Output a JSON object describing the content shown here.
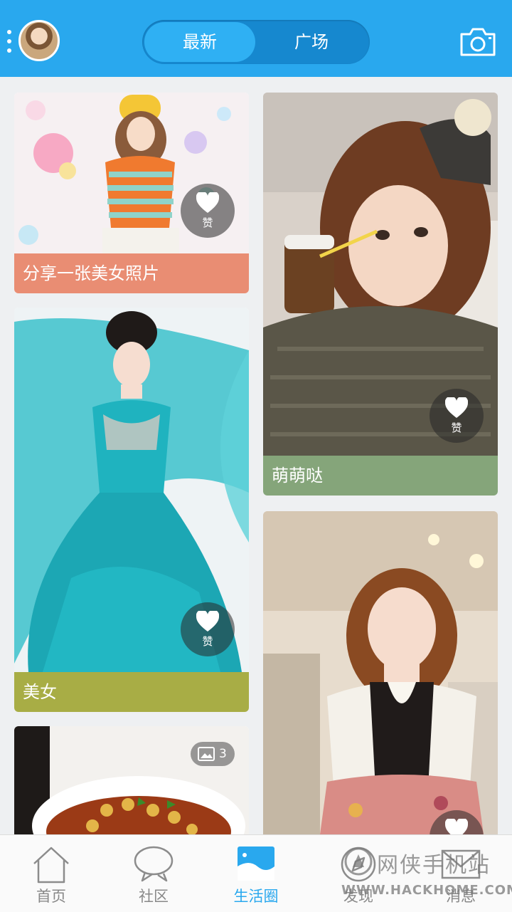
{
  "header": {
    "tabs": [
      {
        "label": "最新",
        "active": true
      },
      {
        "label": "广场",
        "active": false
      }
    ],
    "accent": "#29a8ee"
  },
  "feed": {
    "posts": [
      {
        "caption": "分享一张美女照片",
        "caption_color": "#e98d73",
        "like_label": "赞"
      },
      {
        "caption": "萌萌哒",
        "caption_color": "#85a57a",
        "like_label": "赞"
      },
      {
        "caption": "美女",
        "caption_color": "#a8ad45",
        "like_label": "赞"
      },
      {
        "caption": "",
        "like_label": "赞"
      },
      {
        "caption": "",
        "image_count": "3"
      }
    ]
  },
  "tabbar": {
    "items": [
      {
        "label": "首页",
        "icon": "home-icon"
      },
      {
        "label": "社区",
        "icon": "chat-icon"
      },
      {
        "label": "生活圈",
        "icon": "life-circle-icon",
        "active": true
      },
      {
        "label": "发现",
        "icon": "compass-icon"
      },
      {
        "label": "消息",
        "icon": "mail-icon"
      }
    ]
  },
  "watermark": {
    "cn": "网侠手机站",
    "en": "WWW.HACKHOME.COM"
  }
}
